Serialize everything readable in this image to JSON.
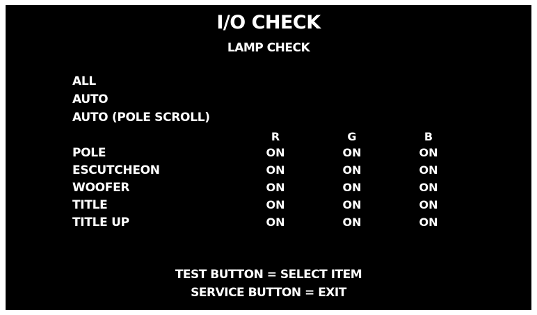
{
  "header": {
    "title": "I/O CHECK",
    "subtitle": "LAMP CHECK"
  },
  "menu": {
    "items": [
      {
        "label": "ALL"
      },
      {
        "label": "AUTO"
      },
      {
        "label": "AUTO (POLE SCROLL)"
      }
    ]
  },
  "table": {
    "columns": [
      "R",
      "G",
      "B"
    ],
    "rows": [
      {
        "label": "POLE",
        "values": [
          "ON",
          "ON",
          "ON"
        ]
      },
      {
        "label": "ESCUTCHEON",
        "values": [
          "ON",
          "ON",
          "ON"
        ]
      },
      {
        "label": "WOOFER",
        "values": [
          "ON",
          "ON",
          "ON"
        ]
      },
      {
        "label": "TITLE",
        "values": [
          "ON",
          "ON",
          "ON"
        ]
      },
      {
        "label": "TITLE UP",
        "values": [
          "ON",
          "ON",
          "ON"
        ]
      }
    ]
  },
  "footer": {
    "line1": "TEST BUTTON = SELECT ITEM",
    "line2": "SERVICE BUTTON = EXIT"
  },
  "colors": {
    "background": "#000000",
    "text": "#ffffff"
  }
}
